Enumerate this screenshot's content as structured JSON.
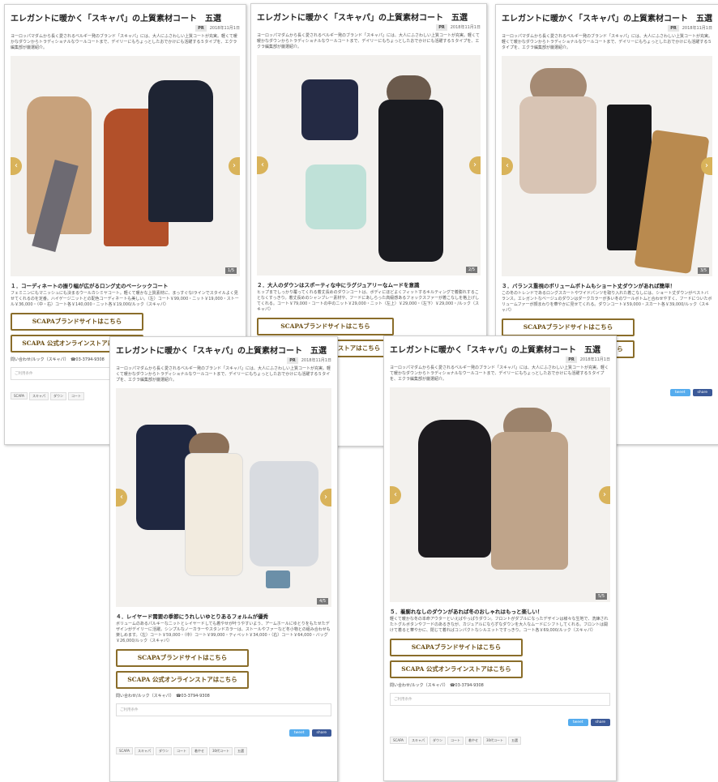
{
  "article": {
    "title": "エレガントに暖かく「スキャパ」の上質素材コート　五選",
    "pr_badge": "PR",
    "date": "2018年11月1日",
    "intro": "ヨーロッパマダムから長く愛されるベルギー発のブランド「スキャパ」には、大人にふさわしい上質コートが充実。軽くて暖かなダウンからトラディショナルなウールコートまで、デイリーにもちょっとしたおでかけにも活躍する５タイプを、エクラ編集部が厳選紹介。"
  },
  "buttons": {
    "brand_site": "SCAPAブランドサイトはこちら",
    "online_store": "SCAPA 公式オンラインストアはこちら"
  },
  "contact": "問い合わせ/ルック（スキャパ）　☎03-3794-9308",
  "comment_placeholder": "ご利用条件",
  "share": {
    "tweet": "tweet",
    "facebook": "share"
  },
  "tags": [
    "SCAPA",
    "スキャパ",
    "ダウン",
    "コート",
    "着やせ",
    "30代コート",
    "五選"
  ],
  "nav": {
    "prev": "‹",
    "next": "›"
  },
  "slides": [
    {
      "counter": "1/5",
      "heading": "１．コーディネートの振り幅が広がるロング丈のベーシックコート",
      "text": "フェミニンにもマニッシュにも決まるウールカシミヤコート。軽くて暖かな上質素材に、まっすぐなIラインでスタイルよく見せてくれるのを定番。ハイゲージニットとの配色コーディネートも美しい。（左）コート￥99,000・ニット￥19,000・ストール￥36,000・（中・右）コート各￥140,000・ニット各￥19,000/ルック（スキャパ）"
    },
    {
      "counter": "2/5",
      "heading": "２．大人のダウンはスポーティな中にラグジュアリーなムードを意識",
      "text": "ヒップまでしっかり覆ってくれる着丈長めのダウンコートは、ボディにほどよくフィットするキルティングで着膨れすることなくすっきり。着丈長めのシャンブレー素材や、フードにあしらった高級感あるフォックスファーが着こなしを格上げしてくれる。コート￥79,000・コートの中のニット￥29,000・ニット（左上）￥29,000・（左下）￥29,000・/ルック（スキャパ）"
    },
    {
      "counter": "3/5",
      "heading": "３．バランス重視のボリュームボトムもショート丈ダウンがあれば簡単！",
      "text": "この冬のトレンドであるロングスカートやワイドパンツを取り入れた着こなしには、ショート丈ダウンがベストバランス。エレガントなベージュのダウンはダークカラーが多い冬のワールボトムと合わせやすく、フードについたボリュームファーが顔まわりを華やかに見せてくれる。ダウンコート￥59,000・スカート各￥39,000/ルック（スキャパ）"
    },
    {
      "counter": "4/5",
      "heading": "４．レイヤード需要の季節にうれしいゆとりあるフォルムが優秀",
      "text": "ボリュームのあるパルキーなニットとレイヤードしても着やせが叶うやすいよう、アームホールにゆとりをもたせたデザインがデイリーに活躍。シンプルなノーカラーやスタンドカラーは、ストールやファーなど冬小物との組み合わせも楽しめます。（左）コート￥59,000・（中）コート￥99,000・ティペット￥34,000・（右）コート￥64,000・バッグ￥26,000/ルック（スキャパ）"
    },
    {
      "counter": "5/5",
      "heading": "５．着膨れなしのダウンがあれば冬のおしゃれはもっと楽しい！",
      "text": "軽くて暖かな冬の本命アウターといえばやっぱりダウン。フロントがダブルになったデザインは様々な生地で、洗練されたトグルボタンやフードのあるきなが、カジュアルにならずなダウンを大人なムードにシフトしてくれる。フロントは開けて着ると華やかに、閉じて着ればコンパクトなシルエットですっきり。コート各￥69,000/ルック（スキャパ）"
    }
  ],
  "colors": {
    "accent_gold": "#d9b35a",
    "button_border": "#8a6d2a",
    "twitter": "#55acee",
    "facebook": "#3b5998"
  }
}
